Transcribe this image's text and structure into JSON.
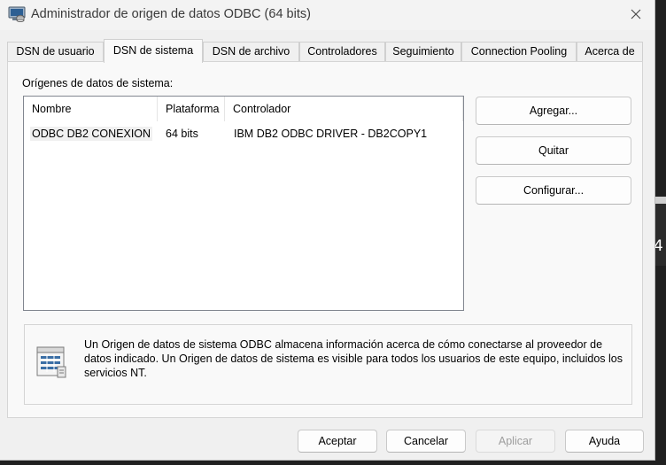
{
  "window": {
    "title": "Administrador de origen de datos ODBC (64 bits)"
  },
  "tabs": [
    {
      "label": "DSN de usuario",
      "active": false
    },
    {
      "label": "DSN de sistema",
      "active": true
    },
    {
      "label": "DSN de archivo",
      "active": false
    },
    {
      "label": "Controladores",
      "active": false
    },
    {
      "label": "Seguimiento",
      "active": false
    },
    {
      "label": "Connection Pooling",
      "active": false
    },
    {
      "label": "Acerca de",
      "active": false
    }
  ],
  "system_dsn": {
    "section_label": "Orígenes de datos de sistema:",
    "columns": [
      "Nombre",
      "Plataforma",
      "Controlador"
    ],
    "rows": [
      {
        "name": "ODBC DB2 CONEXION",
        "platform": "64 bits",
        "driver": "IBM DB2 ODBC DRIVER - DB2COPY1"
      }
    ],
    "buttons": {
      "add": "Agregar...",
      "remove": "Quitar",
      "configure": "Configurar..."
    },
    "info_text": "Un Origen de datos de sistema ODBC almacena información acerca de cómo conectarse al proveedor de datos indicado. Un Origen de datos de sistema es visible para todos los usuarios de este equipo, incluidos los servicios NT."
  },
  "footer": {
    "accept": "Aceptar",
    "cancel": "Cancelar",
    "apply": "Aplicar",
    "help": "Ayuda"
  },
  "background": {
    "digit": "4"
  },
  "icons": {
    "app": "odbc-admin-icon",
    "close": "close-icon",
    "info": "data-source-icon"
  }
}
